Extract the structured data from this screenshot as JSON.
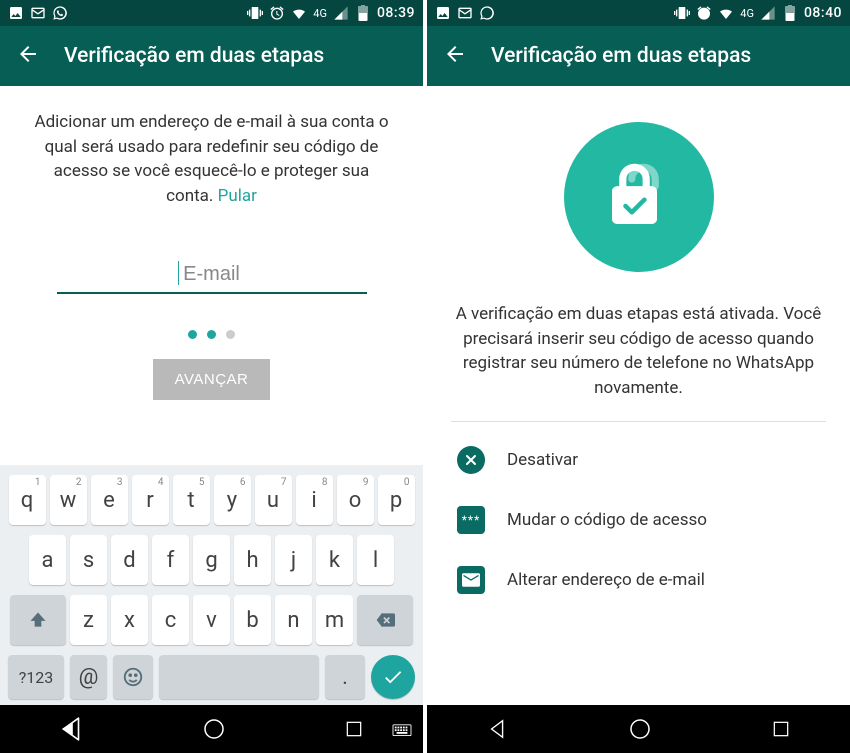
{
  "left": {
    "status": {
      "time": "08:39",
      "net": "4G"
    },
    "title": "Verificação em duas etapas",
    "desc": "Adicionar um endereço de e-mail à sua conta o qual será usado para redefinir seu código de acesso se você esquecê-lo e proteger sua conta. ",
    "skip": "Pular",
    "email_placeholder": "E-mail",
    "advance": "AVANÇAR",
    "keys_row1": [
      "q",
      "w",
      "e",
      "r",
      "t",
      "y",
      "u",
      "i",
      "o",
      "p"
    ],
    "keys_sup": [
      "1",
      "2",
      "3",
      "4",
      "5",
      "6",
      "7",
      "8",
      "9",
      "0"
    ],
    "keys_row2": [
      "a",
      "s",
      "d",
      "f",
      "g",
      "h",
      "j",
      "k",
      "l"
    ],
    "keys_row3": [
      "z",
      "x",
      "c",
      "v",
      "b",
      "n",
      "m"
    ],
    "sym_key": "?123",
    "at_key": "@",
    "dot_key": "."
  },
  "right": {
    "status": {
      "time": "08:40",
      "net": "4G"
    },
    "title": "Verificação em duas etapas",
    "desc": "A verificação em duas etapas está ativada. Você precisará inserir seu código de acesso quando registrar seu número de telefone no WhatsApp novamente.",
    "opt_disable": "Desativar",
    "opt_code": "Mudar o código de acesso",
    "opt_email": "Alterar endereço de e-mail"
  }
}
